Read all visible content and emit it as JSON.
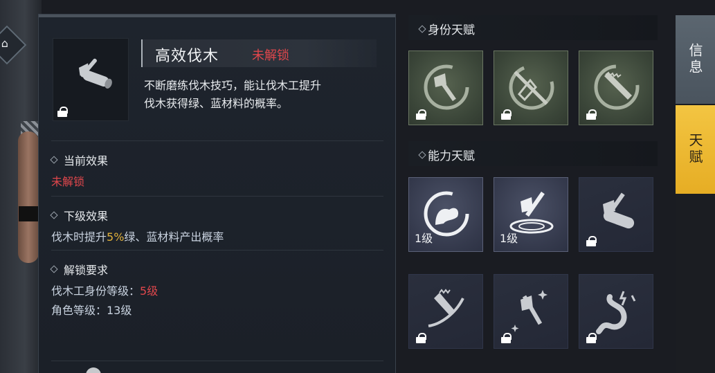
{
  "left_panel": {
    "home_icon": "home-icon"
  },
  "detail": {
    "skill_name": "高效伐木",
    "skill_status": "未解锁",
    "description_line1": "不断磨练伐木技巧，能让伐木工提升",
    "description_line2": "伐木获得绿、蓝材料的概率。",
    "current_effect": {
      "title": "当前效果",
      "value": "未解锁"
    },
    "next_effect": {
      "title": "下级效果",
      "prefix": "伐木时提升",
      "highlight": "5%",
      "suffix": "绿、蓝材料产出概率"
    },
    "unlock_requirements": {
      "title": "解锁要求",
      "req1_label": "伐木工身份等级：",
      "req1_value": "5级",
      "req2": "角色等级：13级"
    }
  },
  "talents": {
    "identity_title": "身份天赋",
    "identity_items": [
      {
        "icon": "axe-emblem-icon",
        "locked": true
      },
      {
        "icon": "axe-emblem-crossed-icon",
        "locked": true
      },
      {
        "icon": "saw-emblem-icon",
        "locked": true
      }
    ],
    "ability_title": "能力天赋",
    "ability_items": [
      {
        "icon": "strength-arm-icon",
        "level": "1级",
        "locked": false
      },
      {
        "icon": "axe-chop-icon",
        "level": "1级",
        "locked": false
      },
      {
        "icon": "axe-log-icon",
        "locked": true
      },
      {
        "icon": "chainsaw-icon",
        "locked": true
      },
      {
        "icon": "sparkle-axe-icon",
        "locked": true
      },
      {
        "icon": "stomach-icon",
        "locked": true
      }
    ]
  },
  "tabs": {
    "info": "信息",
    "talent": "天赋"
  },
  "colors": {
    "locked_red": "#e0474c",
    "highlight_yellow": "#e2b23b",
    "active_tab": "#f3c542"
  }
}
